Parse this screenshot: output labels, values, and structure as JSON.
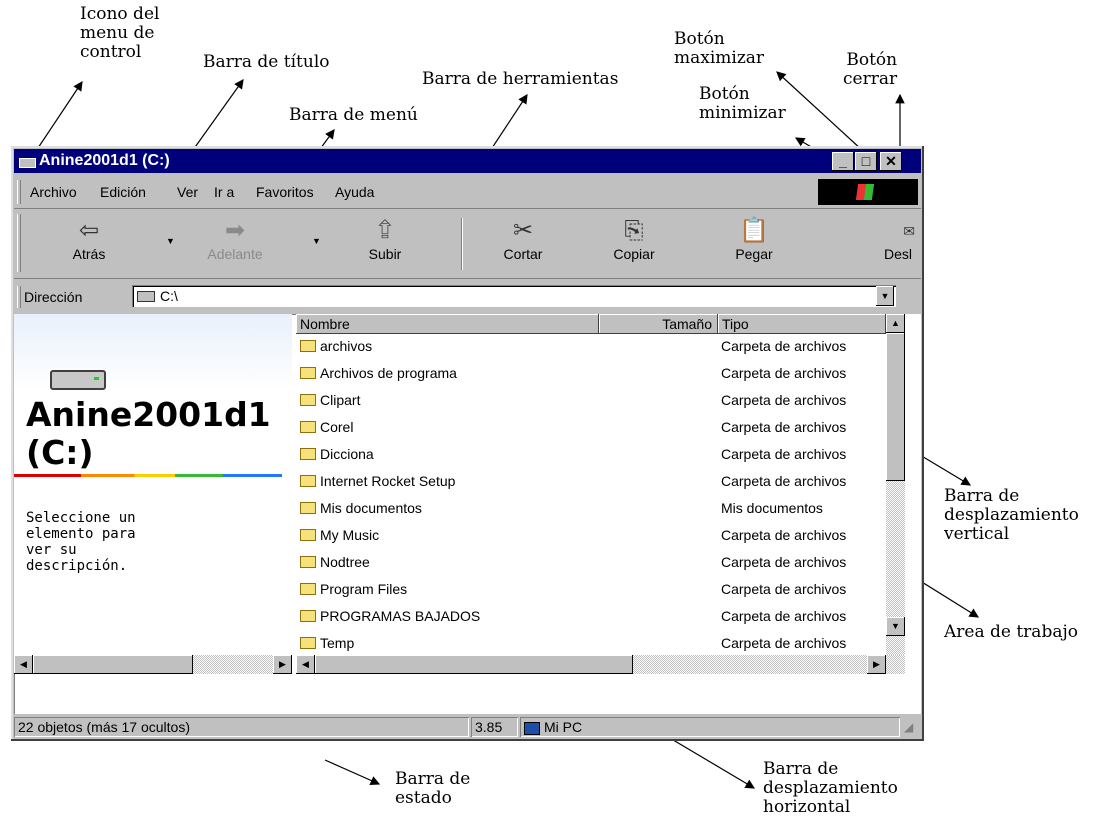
{
  "annotations": {
    "control_menu_icon": "Icono del\nmenu de\ncontrol",
    "title_bar": "Barra de título",
    "menu_bar": "Barra de menú",
    "toolbar": "Barra de herramientas",
    "maximize_button": "Botón\nmaximizar",
    "close_button": "Botón\ncerrar",
    "minimize_button": "Botón\nminimizar",
    "vertical_scrollbar": "Barra de\ndesplazamiento\nvertical",
    "work_area": "Area de trabajo",
    "status_bar": "Barra de\nestado",
    "horizontal_scrollbar": "Barra de\ndesplazamiento\nhorizontal"
  },
  "window": {
    "title": "Anine2001d1 (C:)",
    "colors": {
      "titlebar": "#00007b",
      "chrome": "#c0c0c0"
    }
  },
  "menu": [
    "Archivo",
    "Edición",
    "Ver",
    "Ir a",
    "Favoritos",
    "Ayuda"
  ],
  "toolbar": {
    "back": "Atrás",
    "forward": "Adelante",
    "up": "Subir",
    "cut": "Cortar",
    "copy": "Copiar",
    "paste": "Pegar",
    "undo": "Desl"
  },
  "address": {
    "label": "Dirección",
    "value": "C:\\"
  },
  "left_pane": {
    "title_line1": "Anine2001d1",
    "title_line2": "(C:)",
    "description": "Seleccione un\nelemento para\nver su\ndescripción."
  },
  "columns": {
    "name": "Nombre",
    "size": "Tamaño",
    "type": "Tipo"
  },
  "files": [
    {
      "name": "archivos",
      "type": "Carpeta de archivos"
    },
    {
      "name": "Archivos de programa",
      "type": "Carpeta de archivos"
    },
    {
      "name": "Clipart",
      "type": "Carpeta de archivos"
    },
    {
      "name": "Corel",
      "type": "Carpeta de archivos"
    },
    {
      "name": "Dicciona",
      "type": "Carpeta de archivos"
    },
    {
      "name": "Internet Rocket Setup",
      "type": "Carpeta de archivos"
    },
    {
      "name": "Mis documentos",
      "type": "Mis documentos"
    },
    {
      "name": "My Music",
      "type": "Carpeta de archivos"
    },
    {
      "name": "Nodtree",
      "type": "Carpeta de archivos"
    },
    {
      "name": "Program Files",
      "type": "Carpeta de archivos"
    },
    {
      "name": "PROGRAMAS BAJADOS",
      "type": "Carpeta de archivos"
    },
    {
      "name": "Temp",
      "type": "Carpeta de archivos"
    }
  ],
  "status": {
    "objects": "22 objetos (más 17 ocultos)",
    "size": "3.85",
    "location": "Mi PC"
  }
}
